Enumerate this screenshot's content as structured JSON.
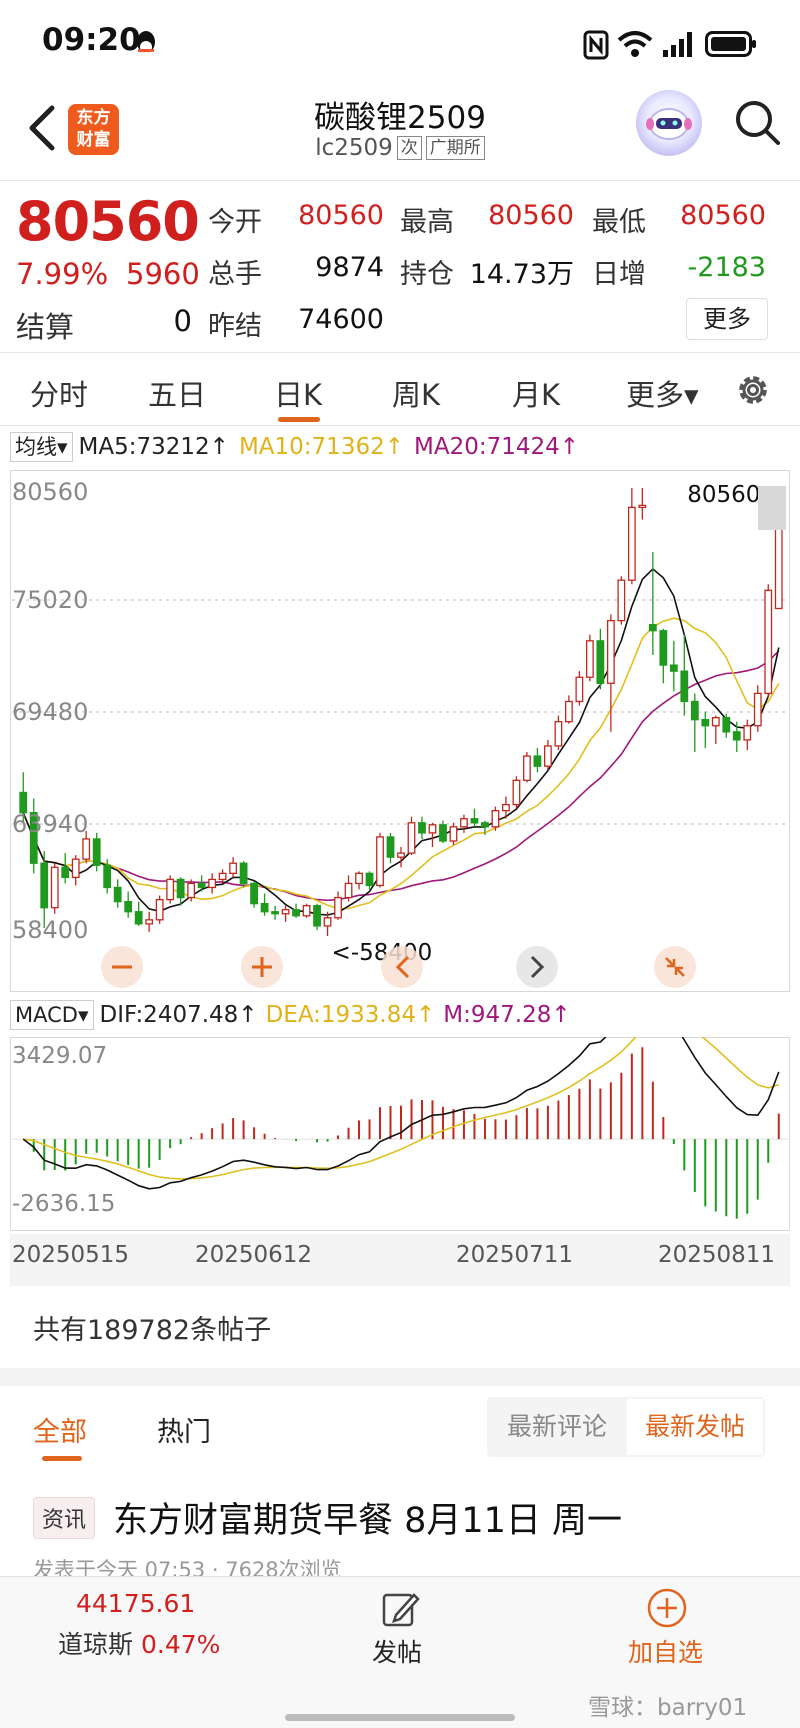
{
  "status_bar": {
    "time": "09:20"
  },
  "header": {
    "title": "碳酸锂2509",
    "code": "lc2509",
    "tag1": "次",
    "tag2": "广期所",
    "logo_line1": "东方",
    "logo_line2": "财富"
  },
  "quote": {
    "price": "80560",
    "change_pct": "7.99%",
    "change": "5960",
    "settle_label": "结算",
    "settle_value": "0",
    "fields": [
      {
        "label": "今开",
        "value": "80560",
        "color": "red"
      },
      {
        "label": "最高",
        "value": "80560",
        "color": "red"
      },
      {
        "label": "最低",
        "value": "80560",
        "color": "red"
      },
      {
        "label": "总手",
        "value": "9874",
        "color": "black"
      },
      {
        "label": "持仓",
        "value": "14.73万",
        "color": "black"
      },
      {
        "label": "日增",
        "value": "-2183",
        "color": "green"
      },
      {
        "label": "昨结",
        "value": "74600",
        "color": "black"
      }
    ],
    "more_label": "更多"
  },
  "tabs": [
    {
      "label": "分时"
    },
    {
      "label": "五日"
    },
    {
      "label": "日K",
      "active": true
    },
    {
      "label": "周K"
    },
    {
      "label": "月K"
    },
    {
      "label": "更多▾"
    }
  ],
  "ma_legend": {
    "select": "均线▾",
    "ma5": "MA5:73212↑",
    "ma10": "MA10:71362↑",
    "ma20": "MA20:71424↑"
  },
  "macd_legend": {
    "select": "MACD▾",
    "dif": "DIF:2407.48↑",
    "dea": "DEA:1933.84↑",
    "m": "M:947.28↑"
  },
  "chart_data": [
    {
      "type": "candlestick",
      "y_ticks": [
        "80560",
        "75020",
        "69480",
        "63940",
        "58400"
      ],
      "ylim": [
        58400,
        80560
      ],
      "annotations": {
        "high": "80560->",
        "low": "<-58400"
      },
      "colors": {
        "up": "#c0281e",
        "down": "#1f9a1f",
        "ma5": "#111111",
        "ma10": "#e0c020",
        "ma20": "#a0187a"
      },
      "candles": [
        [
          65500,
          66500,
          64000,
          64500
        ],
        [
          64500,
          65200,
          61500,
          62000
        ],
        [
          62000,
          62600,
          58800,
          59800
        ],
        [
          59800,
          62000,
          59500,
          61800
        ],
        [
          61800,
          62500,
          61000,
          61300
        ],
        [
          61300,
          62400,
          60900,
          62200
        ],
        [
          62200,
          63600,
          62000,
          63200
        ],
        [
          63200,
          63500,
          61600,
          61900
        ],
        [
          61900,
          62200,
          60500,
          60800
        ],
        [
          60800,
          61200,
          59800,
          60100
        ],
        [
          60100,
          60600,
          59300,
          59600
        ],
        [
          59600,
          60100,
          58900,
          59000
        ],
        [
          59000,
          59600,
          58600,
          59200
        ],
        [
          59200,
          60400,
          59000,
          60200
        ],
        [
          60200,
          61400,
          60000,
          61200
        ],
        [
          61200,
          61300,
          59900,
          60300
        ],
        [
          60300,
          61200,
          60100,
          61000
        ],
        [
          61000,
          61400,
          60600,
          60800
        ],
        [
          60800,
          61500,
          60500,
          61200
        ],
        [
          61200,
          61700,
          61000,
          61500
        ],
        [
          61500,
          62300,
          61300,
          62000
        ],
        [
          62000,
          62100,
          60800,
          61000
        ],
        [
          61000,
          61100,
          59800,
          60000
        ],
        [
          60000,
          60500,
          59400,
          59600
        ],
        [
          59600,
          59900,
          59200,
          59500
        ],
        [
          59500,
          59900,
          59100,
          59700
        ],
        [
          59700,
          60000,
          59300,
          59400
        ],
        [
          59400,
          60000,
          59300,
          59900
        ],
        [
          59900,
          60000,
          58700,
          58900
        ],
        [
          58900,
          59600,
          58400,
          59300
        ],
        [
          59300,
          60600,
          59200,
          60300
        ],
        [
          60300,
          61400,
          60100,
          61000
        ],
        [
          61000,
          61600,
          60700,
          61500
        ],
        [
          61500,
          61600,
          60700,
          60900
        ],
        [
          60900,
          63500,
          60800,
          63300
        ],
        [
          63300,
          63500,
          62000,
          62300
        ],
        [
          62300,
          62800,
          61800,
          62500
        ],
        [
          62500,
          64300,
          62400,
          64000
        ],
        [
          64000,
          64300,
          63200,
          63500
        ],
        [
          63500,
          64000,
          62800,
          63900
        ],
        [
          63900,
          64100,
          63000,
          63100
        ],
        [
          63100,
          64000,
          62900,
          63800
        ],
        [
          63800,
          64400,
          63500,
          64200
        ],
        [
          64200,
          64700,
          63800,
          64000
        ],
        [
          64000,
          64100,
          63400,
          63800
        ],
        [
          63800,
          64800,
          63600,
          64600
        ],
        [
          64600,
          65300,
          64200,
          64900
        ],
        [
          64900,
          66300,
          64700,
          66100
        ],
        [
          66100,
          67500,
          66000,
          67300
        ],
        [
          67300,
          67700,
          66500,
          66800
        ],
        [
          66800,
          68100,
          66600,
          67800
        ],
        [
          67800,
          69300,
          67600,
          69000
        ],
        [
          69000,
          70300,
          68900,
          70000
        ],
        [
          70000,
          71500,
          69800,
          71200
        ],
        [
          71200,
          73300,
          71000,
          73000
        ],
        [
          73000,
          73600,
          70600,
          70900
        ],
        [
          70900,
          74300,
          68500,
          74000
        ],
        [
          74000,
          76200,
          73800,
          76000
        ],
        [
          76000,
          80560,
          75800,
          79600
        ],
        [
          79600,
          80560,
          79000,
          79700
        ],
        [
          73800,
          77400,
          72300,
          73500
        ],
        [
          73500,
          73600,
          70900,
          71800
        ],
        [
          71800,
          73000,
          70500,
          71500
        ],
        [
          71500,
          73300,
          69300,
          70000
        ],
        [
          70000,
          70400,
          67500,
          69100
        ],
        [
          69100,
          69500,
          67700,
          68800
        ],
        [
          68800,
          69300,
          67900,
          69200
        ],
        [
          69200,
          69400,
          68200,
          68500
        ],
        [
          68500,
          69000,
          67500,
          68100
        ],
        [
          68100,
          69100,
          67600,
          68800
        ],
        [
          68800,
          70800,
          68500,
          70400
        ],
        [
          70400,
          75800,
          70200,
          75500
        ],
        [
          74600,
          80560,
          74600,
          80560
        ]
      ]
    },
    {
      "type": "macd",
      "y_ticks": [
        "3429.07",
        "-2636.15"
      ],
      "ylim": [
        -2636.15,
        3429.07
      ],
      "dif_end": 2407.48,
      "dea_end": 1933.84,
      "m_end": 947.28,
      "colors": {
        "dif": "#111111",
        "dea": "#e0c020",
        "pos": "#c0281e",
        "neg": "#1f9a1f"
      }
    }
  ],
  "date_axis": [
    "20250515",
    "20250612",
    "20250711",
    "20250811"
  ],
  "posts": {
    "count_text": "共有189782条帖子",
    "tabs": [
      {
        "label": "全部",
        "active": true
      },
      {
        "label": "热门"
      }
    ],
    "sort": [
      "最新评论",
      "最新发帖"
    ],
    "news": {
      "tag": "资讯",
      "title": "东方财富期货早餐 8月11日 周一",
      "meta": "发表于今天 07:53 · 7628次浏览"
    }
  },
  "bottom_bar": {
    "index_value": "44175.61",
    "index_name": "道琼斯",
    "index_pct": "0.47%",
    "post_label": "发帖",
    "add_label": "加自选"
  },
  "watermark": "雪球：barry01"
}
